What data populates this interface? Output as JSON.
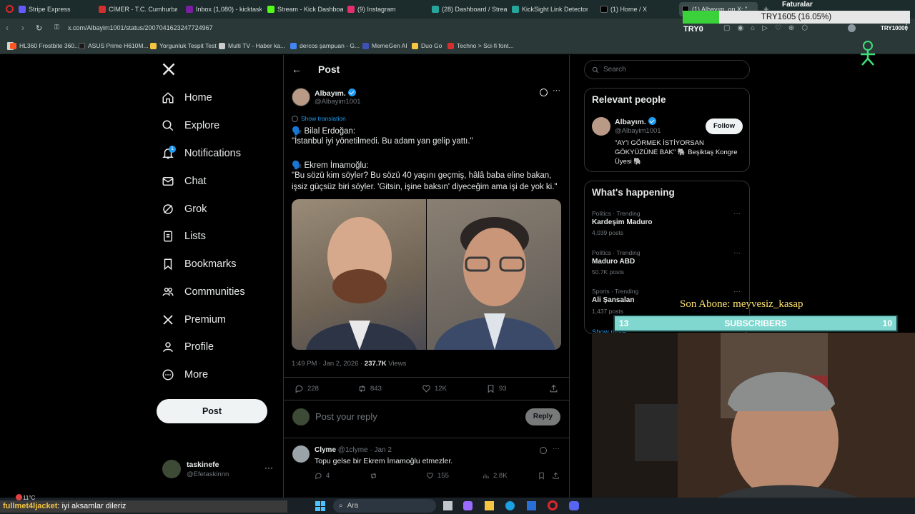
{
  "browser": {
    "tabs": [
      {
        "label": "Stripe Express",
        "color": "#635bff"
      },
      {
        "label": "CİMER - T.C. Cumhurbaşk",
        "color": "#d32f2f"
      },
      {
        "label": "Inbox (1,080) - kicktaskine",
        "color": "#7b1fa2"
      },
      {
        "label": "Stream - Kick Dashboard",
        "color": "#53fc18"
      },
      {
        "label": "(9) Instagram",
        "color": "#e1306c"
      },
      {
        "label": "(28) Dashboard / Streamla",
        "color": "#26a69a"
      },
      {
        "label": "KickSight Link Detector",
        "color": "#26a69a"
      },
      {
        "label": "(1) Home / X",
        "color": "#000000"
      },
      {
        "label": "(1) Albayım. on X: \"",
        "color": "#000000"
      }
    ],
    "url": "x.com/Albayim1001/status/2007041623247724967",
    "bookmarks": [
      {
        "label": "HL360 Frostbite 360...",
        "color": "#ff5722"
      },
      {
        "label": "ASUS Prime H610M...",
        "color": "#1a1a1a"
      },
      {
        "label": "Yorgunluk Tespit Test",
        "color": "#f5c542"
      },
      {
        "label": "Multi TV - Haber ka...",
        "color": "#cccccc"
      },
      {
        "label": "dercos şampuan - G...",
        "color": "#4285f4"
      },
      {
        "label": "MemeGen AI",
        "color": "#3f51b5"
      },
      {
        "label": "Duo Go",
        "color": "#f5c542"
      },
      {
        "label": "Techno > Sci-fi font...",
        "color": "#d32f2f"
      }
    ]
  },
  "overlay": {
    "faturalar": "Faturalar",
    "currency_top": "TRY1605 (16.05%)",
    "currency_left": "TRY0",
    "currency_right": "TRY10000",
    "son_abone": "Son Abone: meyvesiz_kasap",
    "sub_left": "13",
    "sub_label": "SUBSCRIBERS",
    "sub_right": "10",
    "chat_user": "fullmet4ljacket",
    "chat_msg": ": iyi aksamlar dileriz",
    "weather": "11°C",
    "search_placeholder": "Ara"
  },
  "nav": {
    "items": [
      {
        "label": "Home",
        "icon": "home-icon"
      },
      {
        "label": "Explore",
        "icon": "search-icon"
      },
      {
        "label": "Notifications",
        "icon": "bell-icon",
        "badge": "1"
      },
      {
        "label": "Chat",
        "icon": "mail-icon"
      },
      {
        "label": "Grok",
        "icon": "grok-icon"
      },
      {
        "label": "Lists",
        "icon": "list-icon"
      },
      {
        "label": "Bookmarks",
        "icon": "bookmark-icon"
      },
      {
        "label": "Communities",
        "icon": "communities-icon"
      },
      {
        "label": "Premium",
        "icon": "x-logo-icon"
      },
      {
        "label": "Profile",
        "icon": "profile-icon"
      },
      {
        "label": "More",
        "icon": "more-circle-icon"
      }
    ],
    "post_label": "Post",
    "account": {
      "name": "taskinefe",
      "handle": "@Efetaskinnn"
    }
  },
  "post": {
    "header": "Post",
    "author_name": "Albayım.",
    "author_handle": "@Albayim1001",
    "show_translation": "Show translation",
    "lines": [
      "🗣️ Bilal Erdoğan:",
      "\"İstanbul iyi yönetilmedi. Bu adam yan gelip yattı.\"",
      "🗣️ Ekrem İmamoğlu:",
      "\"Bu sözü kim söyler? Bu sözü 40 yaşını geçmiş, hâlâ baba eline bakan,",
      "işsiz güçsüz biri söyler. 'Gitsin, işine baksın' diyeceğim ama işi de yok ki.\""
    ],
    "time": "1:49 PM · Jan 2, 2026 · ",
    "views_count": "237.7K",
    "views_label": " Views",
    "replies": "228",
    "reposts": "843",
    "likes": "12K",
    "bookmarks": "93",
    "reply_placeholder": "Post your reply",
    "reply_button": "Reply"
  },
  "reply": {
    "name": "Clyme",
    "handle": "@1clyme",
    "date": "· Jan 2",
    "text": "Topu gelse bir Ekrem İmamoğlu etmezler.",
    "replies": "4",
    "likes": "155",
    "views": "2.8K"
  },
  "sidebar": {
    "search_placeholder": "Search",
    "relevant_title": "Relevant people",
    "person_name": "Albayım.",
    "person_handle": "@Albayim1001",
    "follow": "Follow",
    "bio": "\"AY'I GÖRMEK İSTİYORSAN GÖKYÜZÜNE BAK\" 🐘 Beşiktaş Kongre Üyesi 🐘",
    "happening_title": "What's happening",
    "trends": [
      {
        "category": "Politics · Trending",
        "name": "Kardeşim Maduro",
        "posts": "4,039 posts"
      },
      {
        "category": "Politics · Trending",
        "name": "Maduro ABD",
        "posts": "50.7K posts"
      },
      {
        "category": "Sports · Trending",
        "name": "Ali Şansalan",
        "posts": "1,437 posts"
      }
    ],
    "show_more": "Show more"
  }
}
